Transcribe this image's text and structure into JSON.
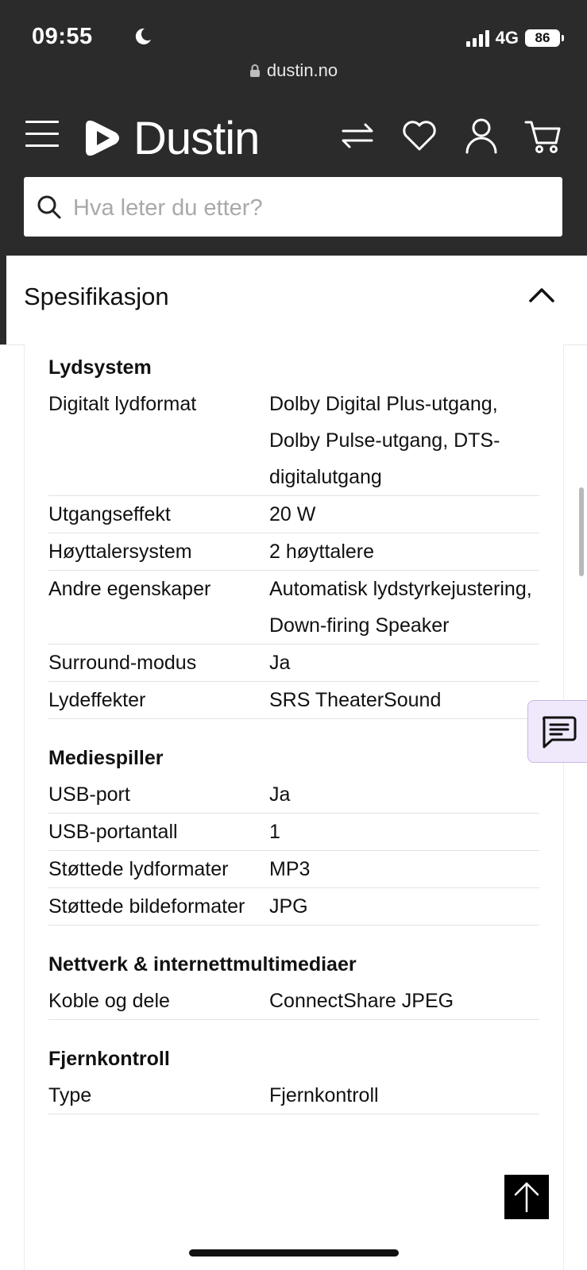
{
  "status_bar": {
    "time": "09:55",
    "network": "4G",
    "battery": "86"
  },
  "browser": {
    "url": "dustin.no"
  },
  "header": {
    "logo_text": "Dustin",
    "search_placeholder": "Hva leter du etter?"
  },
  "accordion": {
    "title": "Spesifikasjon"
  },
  "spec_groups": [
    {
      "title": "Lydsystem",
      "rows": [
        {
          "key": "Digitalt lydformat",
          "value": "Dolby Digital Plus-utgang, Dolby Pulse-utgang, DTS-digitalutgang"
        },
        {
          "key": "Utgangseffekt",
          "value": "20 W"
        },
        {
          "key": "Høyttalersystem",
          "value": "2 høyttalere"
        },
        {
          "key": "Andre egenskaper",
          "value": "Automatisk lydstyrkejustering, Down-firing Speaker"
        },
        {
          "key": "Surround-modus",
          "value": "Ja"
        },
        {
          "key": "Lydeffekter",
          "value": "SRS TheaterSound"
        }
      ]
    },
    {
      "title": "Mediespiller",
      "rows": [
        {
          "key": "USB-port",
          "value": "Ja"
        },
        {
          "key": "USB-portantall",
          "value": "1"
        },
        {
          "key": "Støttede lydformater",
          "value": "MP3"
        },
        {
          "key": "Støttede bildeformater",
          "value": "JPG"
        }
      ]
    },
    {
      "title": "Nettverk & internettmultimediaer",
      "rows": [
        {
          "key": "Koble og dele",
          "value": "ConnectShare JPEG"
        }
      ]
    },
    {
      "title": "Fjernkontroll",
      "rows": [
        {
          "key": "Type",
          "value": "Fjernkontroll"
        }
      ]
    }
  ],
  "colors": {
    "header_bg": "#2b2b2b",
    "chat_bg": "#f0e8fb",
    "text": "#111111"
  }
}
